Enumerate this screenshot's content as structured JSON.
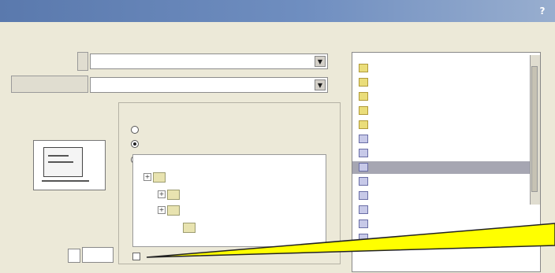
{
  "window": {
    "title": "",
    "help_glyph": "?"
  },
  "colors": {
    "titlebar": "#5a79ad",
    "dialog_bg": "#ece9d8",
    "selection": "#a6a6b2",
    "callout": "#ffff00"
  },
  "left": {
    "section_label": "",
    "first_label": "",
    "first_combo_value": "",
    "second_label": "",
    "second_combo_value": "",
    "preview_label": "",
    "bottom_label_1": "",
    "bottom_label_2": "",
    "bottom_value": ""
  },
  "middle": {
    "group_label": "",
    "radio_labels": [
      "",
      "",
      ""
    ],
    "tree": [
      {
        "sign": "+",
        "label": ""
      },
      {
        "sign": "+",
        "label": ""
      },
      {
        "sign": "+",
        "label": ""
      },
      {
        "sign": "",
        "label": ""
      }
    ],
    "bottom_checkbox_label": ""
  },
  "right": {
    "header": "",
    "items": [
      {
        "label": "",
        "kind": "folder",
        "selected": false
      },
      {
        "label": "",
        "kind": "folder",
        "selected": false
      },
      {
        "label": "",
        "kind": "folder",
        "selected": false
      },
      {
        "label": "",
        "kind": "folder",
        "selected": false
      },
      {
        "label": "",
        "kind": "folder",
        "selected": false
      },
      {
        "label": "",
        "kind": "font",
        "selected": false
      },
      {
        "label": "",
        "kind": "font",
        "selected": false
      },
      {
        "label": "",
        "kind": "font",
        "selected": true
      },
      {
        "label": "",
        "kind": "font",
        "selected": false
      },
      {
        "label": "",
        "kind": "font",
        "selected": false
      },
      {
        "label": "",
        "kind": "font",
        "selected": false
      },
      {
        "label": "",
        "kind": "font",
        "selected": false
      },
      {
        "label": "",
        "kind": "font",
        "selected": false
      }
    ]
  }
}
